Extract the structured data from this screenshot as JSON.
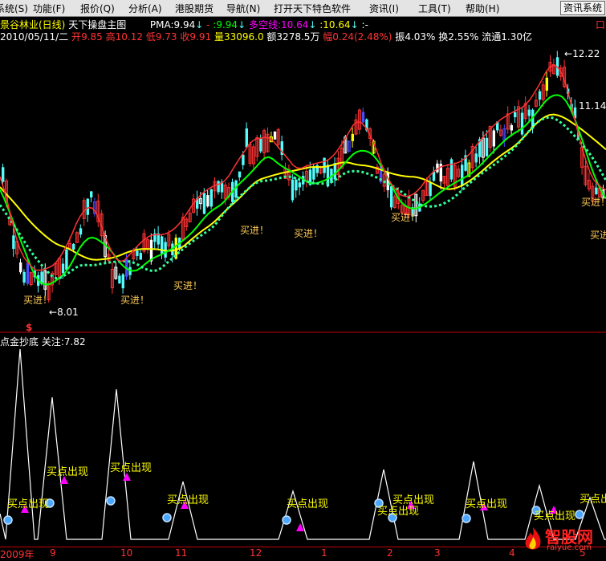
{
  "menu": {
    "items": [
      "系统(S)",
      "功能(F)",
      "报价(Q)",
      "分析(A)",
      "港股期货",
      "导航(N)",
      "打开天下特色软件",
      "资讯(I)",
      "工具(T)",
      "帮助(H)"
    ],
    "system_button": "资讯系统"
  },
  "header": {
    "stock_name": "景谷林业(日线)",
    "chart_title": "天下操盘主图",
    "pma_label": "PMA:",
    "pma_value": "9.94",
    "arrow_down": "↓",
    "dash": "-",
    "pma2": ":9.94",
    "duokong_label": "多空线:",
    "duokong_value": "10.64",
    "last_value": ":10.64",
    "colon": ":-",
    "date": "2010/05/11/二",
    "open_label": "开",
    "open": "9.85",
    "high_label": "高",
    "high": "10.12",
    "low_label": "低",
    "low": "9.73",
    "close_label": "收",
    "close": "9.91",
    "vol_label": "量",
    "vol": "33096.0",
    "amount_label": "额",
    "amount": "3278.5万",
    "change_label": "幅",
    "change": "0.24(2.48%)",
    "amp_label": "振",
    "amp": "4.03%",
    "turnover_label": "换",
    "turnover": "2.55%",
    "float_label": "流通",
    "float": "1.30亿"
  },
  "main_chart": {
    "high_label": "12.22",
    "low_label": "8.01",
    "ref_label": "11.14",
    "buy_signal_text": "买进！",
    "corner_label": "口"
  },
  "sub_chart": {
    "title": "点金抄底",
    "watch_label": "关注:",
    "watch_value": "7.82",
    "s_marker": "$",
    "buy_point_text": "买点出现"
  },
  "axis": {
    "ticks": [
      {
        "label": "2009年",
        "year": true
      },
      {
        "label": "9"
      },
      {
        "label": "10"
      },
      {
        "label": "11"
      },
      {
        "label": "12"
      },
      {
        "label": "1"
      },
      {
        "label": "2"
      },
      {
        "label": "3"
      },
      {
        "label": "4"
      },
      {
        "label": "5"
      }
    ]
  },
  "watermark": {
    "brand": "智股网",
    "url": "raiyue.com"
  },
  "colors": {
    "up": "#ff3333",
    "down": "#54fcfc",
    "white_bar": "#ffffff",
    "blue_bar": "#4a4aff",
    "yellow_line": "#ffff00",
    "green_line": "#00ff00",
    "dotted_line": "#33ff99",
    "divider": "#c00000",
    "signal_text": "#ffcc55",
    "magenta": "#ff00ff"
  }
}
